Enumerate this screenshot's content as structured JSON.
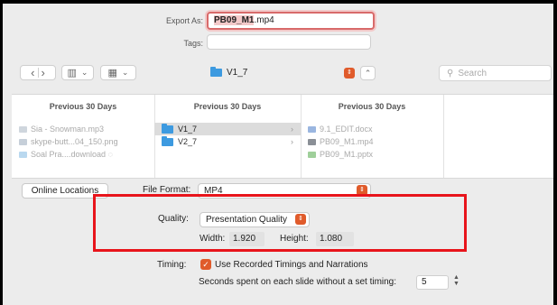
{
  "export": {
    "label": "Export As:",
    "filename_selected": "PB09_M1",
    "filename_ext": ".mp4",
    "tags_label": "Tags:",
    "tags_value": ""
  },
  "toolbar": {
    "back_glyph": "‹",
    "forward_glyph": "›",
    "view_glyph": "▥",
    "group_glyph": "▦",
    "chevron_glyph": "⌄",
    "location_folder": "V1_7",
    "expand_glyph": "⌃",
    "search_placeholder": "Search"
  },
  "browser": {
    "columns": [
      {
        "header": "Previous 30 Days",
        "items": [
          {
            "name": "Sia - Snowman.mp3"
          },
          {
            "name": "skype-butt...04_150.png"
          },
          {
            "name": "Soal Pra....download"
          }
        ]
      },
      {
        "header": "Previous 30 Days",
        "items": [
          {
            "name": "V1_7",
            "selected": true
          },
          {
            "name": "V2_7"
          }
        ]
      },
      {
        "header": "Previous 30 Days",
        "items": [
          {
            "name": "9.1_EDIT.docx"
          },
          {
            "name": "PB09_M1.mp4"
          },
          {
            "name": "PB09_M1.pptx"
          }
        ]
      }
    ],
    "chevron": "›"
  },
  "options": {
    "online_locations": "Online Locations",
    "file_format_label": "File Format:",
    "file_format_value": "MP4",
    "quality_label": "Quality:",
    "quality_value": "Presentation Quality",
    "width_label": "Width:",
    "width_value": "1.920",
    "height_label": "Height:",
    "height_value": "1.080",
    "timing_label": "Timing:",
    "use_recorded": "Use Recorded Timings and Narrations",
    "use_recorded_checked": true,
    "seconds_label": "Seconds spent on each slide without a set timing:",
    "seconds_value": "5"
  },
  "colors": {
    "accent": "#e05b2b",
    "folder": "#3d9ae0",
    "highlight": "#e8141b"
  }
}
